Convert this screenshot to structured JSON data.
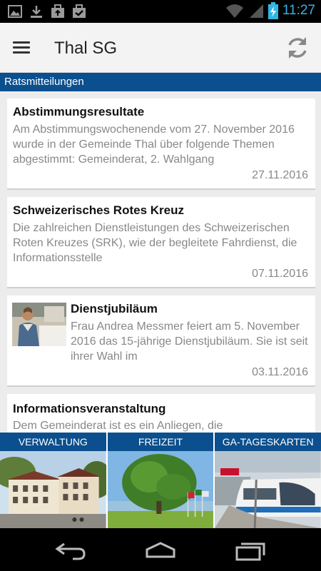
{
  "status_bar": {
    "time": "11:27",
    "icons": [
      "gallery-icon",
      "download-icon",
      "briefcase-icon",
      "briefcase-check-icon",
      "wifi-icon",
      "signal-icon",
      "battery-charging-icon"
    ]
  },
  "app_bar": {
    "title": "Thal SG",
    "menu_icon": "menu-icon",
    "refresh_icon": "refresh-icon"
  },
  "section": {
    "title": "Ratsmitteilungen"
  },
  "news": [
    {
      "title": "Abstimmungsresultate",
      "snippet": "Am Abstimmungswochenende vom 27. November 2016 wurde in der Gemeinde Thal über folgende Themen abgestimmt: Gemeinderat, 2. Wahlgang",
      "date": "27.11.2016"
    },
    {
      "title": "Schweizerisches Rotes Kreuz",
      "snippet": "Die zahlreichen Dienstleistungen des Schweizerischen Roten Kreuzes (SRK), wie der begleitete Fahrdienst, die Informationsstelle",
      "date": "07.11.2016"
    },
    {
      "title": "Dienstjubiläum",
      "snippet": "Frau Andrea Messmer feiert am 5. November 2016 das 15-jährige Dienstjubiläum. Sie ist seit ihrer Wahl im",
      "date": "03.11.2016"
    },
    {
      "title": "Informationsveranstaltung",
      "snippet": "Dem Gemeinderat ist es ein Anliegen, die",
      "date": ""
    }
  ],
  "tiles": [
    {
      "label": "VERWALTUNG"
    },
    {
      "label": "FREIZEIT"
    },
    {
      "label": "GA-TAGESKARTEN"
    }
  ],
  "nav_bar": {
    "icons": [
      "back-icon",
      "home-icon",
      "recent-apps-icon"
    ]
  },
  "colors": {
    "accent": "#0b4f8e",
    "status_time": "#33b5e5"
  }
}
